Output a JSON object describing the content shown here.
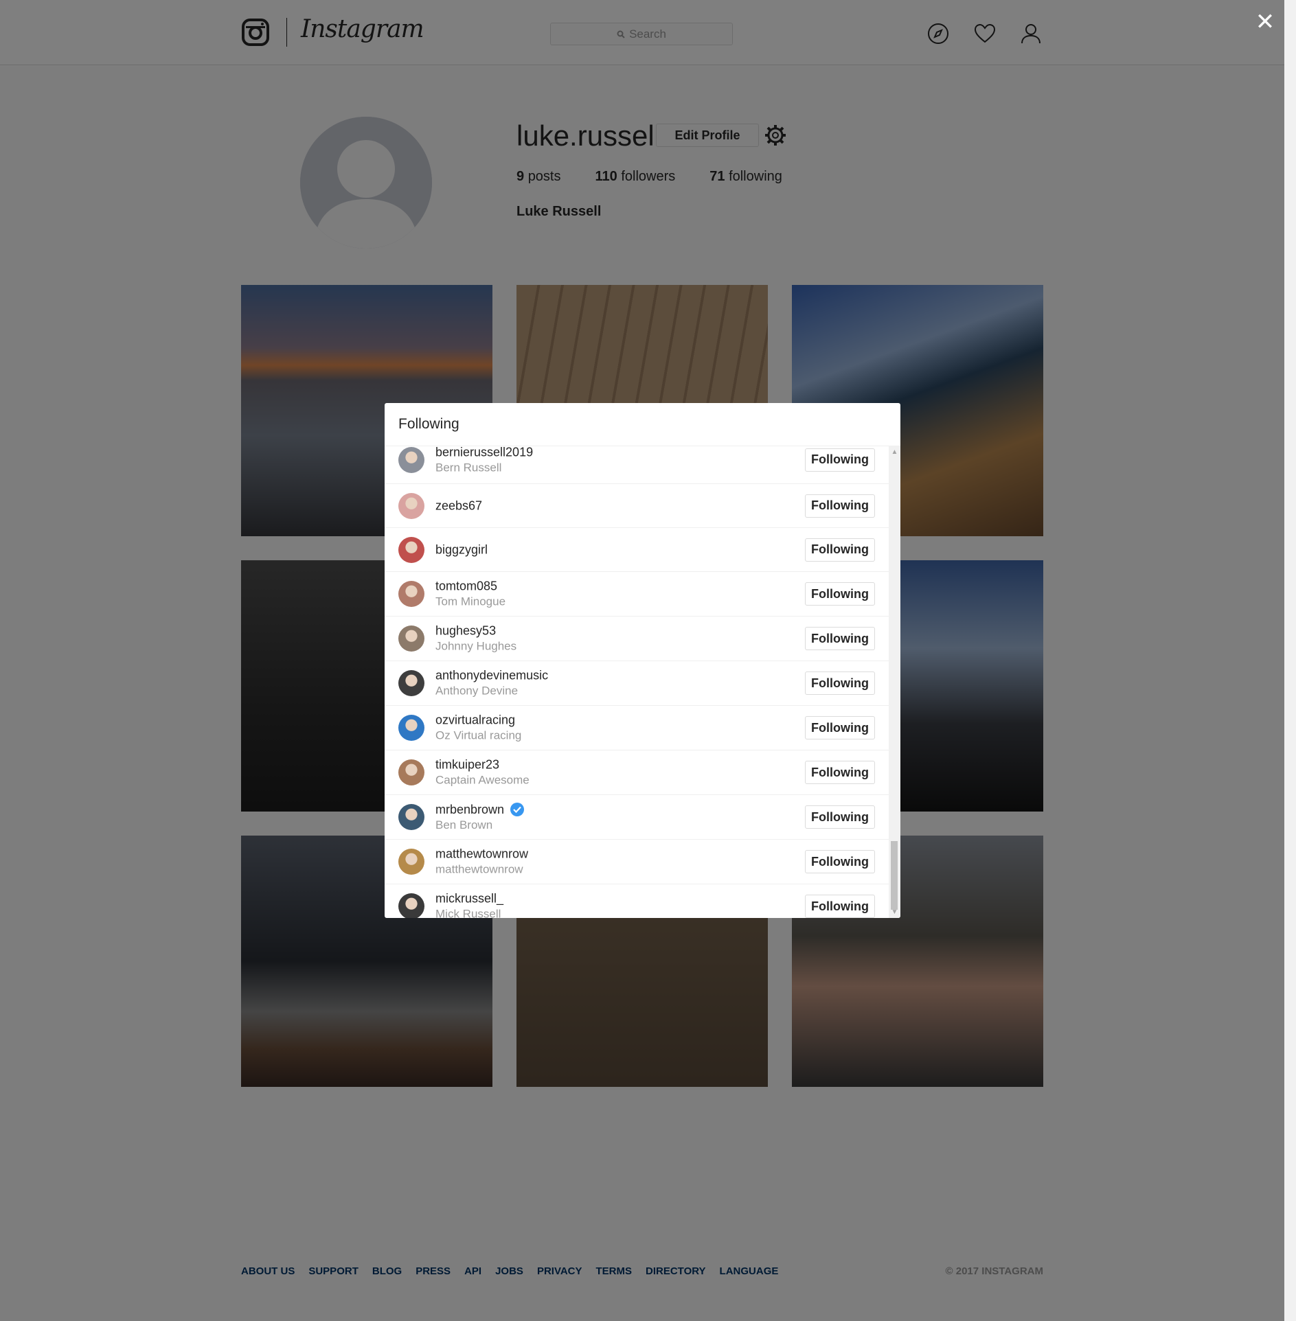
{
  "header": {
    "wordmark": "Instagram",
    "search_placeholder": "Search"
  },
  "profile": {
    "username": "luke.russell",
    "edit_label": "Edit Profile",
    "posts_count": "9",
    "posts_label": "posts",
    "followers_count": "110",
    "followers_label": "followers",
    "following_count": "71",
    "following_label": "following",
    "full_name": "Luke Russell"
  },
  "modal": {
    "title": "Following",
    "items": [
      {
        "username": "bernierussell2019",
        "name": "Bern Russell",
        "button": "Following",
        "verified": false
      },
      {
        "username": "zeebs67",
        "name": "",
        "button": "Following",
        "verified": false
      },
      {
        "username": "biggzygirl",
        "name": "",
        "button": "Following",
        "verified": false
      },
      {
        "username": "tomtom085",
        "name": "Tom Minogue",
        "button": "Following",
        "verified": false
      },
      {
        "username": "hughesy53",
        "name": "Johnny Hughes",
        "button": "Following",
        "verified": false
      },
      {
        "username": "anthonydevinemusic",
        "name": "Anthony Devine",
        "button": "Following",
        "verified": false
      },
      {
        "username": "ozvirtualracing",
        "name": "Oz Virtual racing",
        "button": "Following",
        "verified": false
      },
      {
        "username": "timkuiper23",
        "name": "Captain Awesome",
        "button": "Following",
        "verified": false
      },
      {
        "username": "mrbenbrown",
        "name": "Ben Brown",
        "button": "Following",
        "verified": true
      },
      {
        "username": "matthewtownrow",
        "name": "matthewtownrow",
        "button": "Following",
        "verified": false
      },
      {
        "username": "mickrussell_",
        "name": "Mick Russell",
        "button": "Following",
        "verified": false
      }
    ]
  },
  "footer": {
    "links": [
      "ABOUT US",
      "SUPPORT",
      "BLOG",
      "PRESS",
      "API",
      "JOBS",
      "PRIVACY",
      "TERMS",
      "DIRECTORY",
      "LANGUAGE"
    ],
    "copyright": "© 2017 INSTAGRAM"
  },
  "icons": {
    "close": "close-icon",
    "explore": "compass-icon",
    "activity": "heart-icon",
    "profile": "person-icon",
    "settings": "gear-icon",
    "verified": "verified-badge-icon"
  },
  "colors": {
    "link": "#003569",
    "verified": "#3897f0",
    "text": "#262626",
    "muted": "#999999"
  }
}
